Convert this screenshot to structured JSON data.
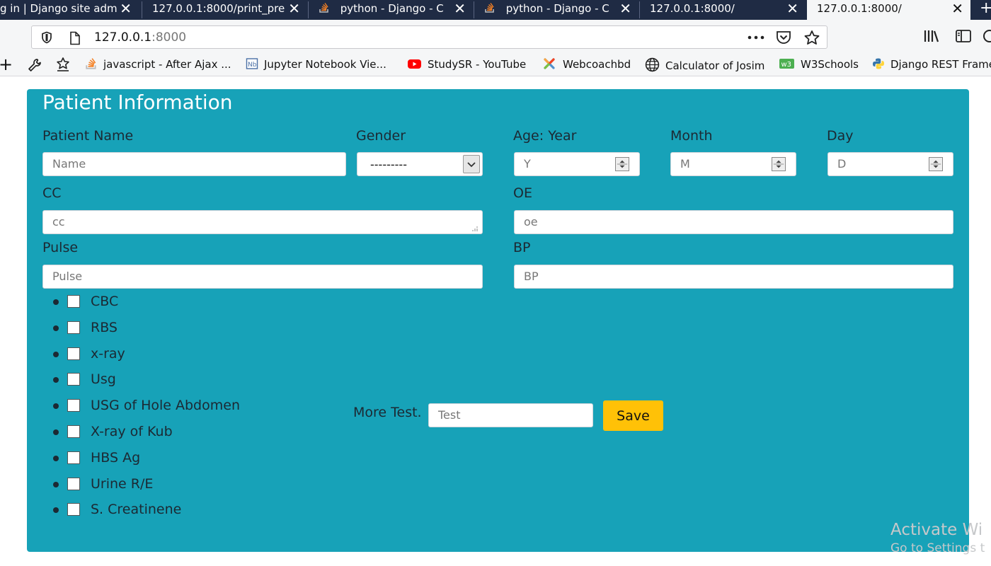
{
  "browser": {
    "tabs": [
      {
        "title": "g in | Django site adm",
        "active": false
      },
      {
        "title": "127.0.0.1:8000/print_pre",
        "active": false
      },
      {
        "title": "python - Django - C",
        "active": false
      },
      {
        "title": "python - Django - C",
        "active": false
      },
      {
        "title": "127.0.0.1:8000/",
        "active": false
      },
      {
        "title": "127.0.0.1:8000/",
        "active": true
      }
    ],
    "url": {
      "host": "127.0.0.1",
      "port": ":8000"
    },
    "bookmarks": [
      {
        "label": "javascript - After Ajax ...",
        "icon": "stackoverflow-icon"
      },
      {
        "label": "Jupyter Notebook Vie...",
        "icon": "notebook-icon"
      },
      {
        "label": "StudySR - YouTube",
        "icon": "youtube-icon"
      },
      {
        "label": "Webcoachbd",
        "icon": "joomla-icon"
      },
      {
        "label": "Calculator of Josim",
        "icon": "globe-icon"
      },
      {
        "label": "W3Schools",
        "icon": "w3schools-icon"
      },
      {
        "label": "Django REST Frame",
        "icon": "python-icon"
      }
    ]
  },
  "form": {
    "title": "Patient Information",
    "patient_name": {
      "label": "Patient Name",
      "placeholder": "Name"
    },
    "gender": {
      "label": "Gender",
      "selected": "---------"
    },
    "age_year": {
      "label": "Age: Year",
      "placeholder": "Y"
    },
    "month": {
      "label": "Month",
      "placeholder": "M"
    },
    "day": {
      "label": "Day",
      "placeholder": "D"
    },
    "cc": {
      "label": "CC",
      "placeholder": "cc"
    },
    "oe": {
      "label": "OE",
      "placeholder": "oe"
    },
    "pulse": {
      "label": "Pulse",
      "placeholder": "Pulse"
    },
    "bp": {
      "label": "BP",
      "placeholder": "BP"
    },
    "tests": [
      "CBC",
      "RBS",
      "x-ray",
      "Usg",
      "USG of Hole Abdomen",
      "X-ray of Kub",
      "HBS Ag",
      "Urine R/E",
      "S. Creatinene"
    ],
    "more_test": {
      "label": "More Test.",
      "placeholder": "Test"
    },
    "save_label": "Save"
  },
  "watermark": {
    "line1": "Activate Wi",
    "line2": "Go to Settings t"
  },
  "colors": {
    "card": "#17a2b8",
    "save": "#ffc107",
    "tabstrip": "#1f2b44"
  }
}
